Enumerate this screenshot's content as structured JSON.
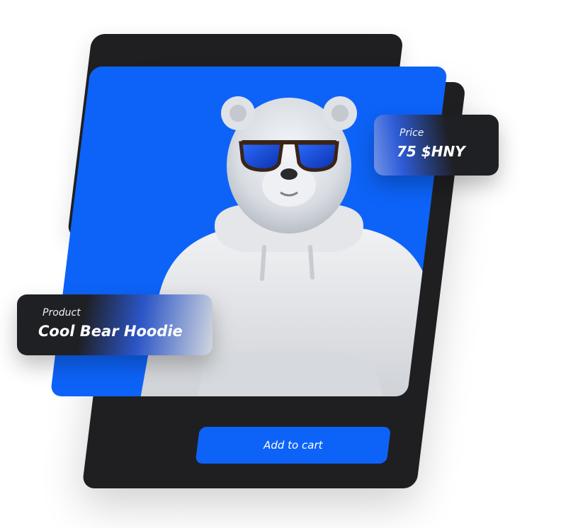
{
  "product": {
    "label": "Product",
    "name": "Cool Bear Hoodie"
  },
  "price": {
    "label": "Price",
    "value": "75 $HNY"
  },
  "actions": {
    "add_to_cart": "Add to cart"
  },
  "image": {
    "subject": "polar bear wearing blue sunglasses and white hoodie",
    "background": "#0d63f8"
  },
  "colors": {
    "accent": "#0d63f8",
    "panel": "#1f1f22"
  }
}
